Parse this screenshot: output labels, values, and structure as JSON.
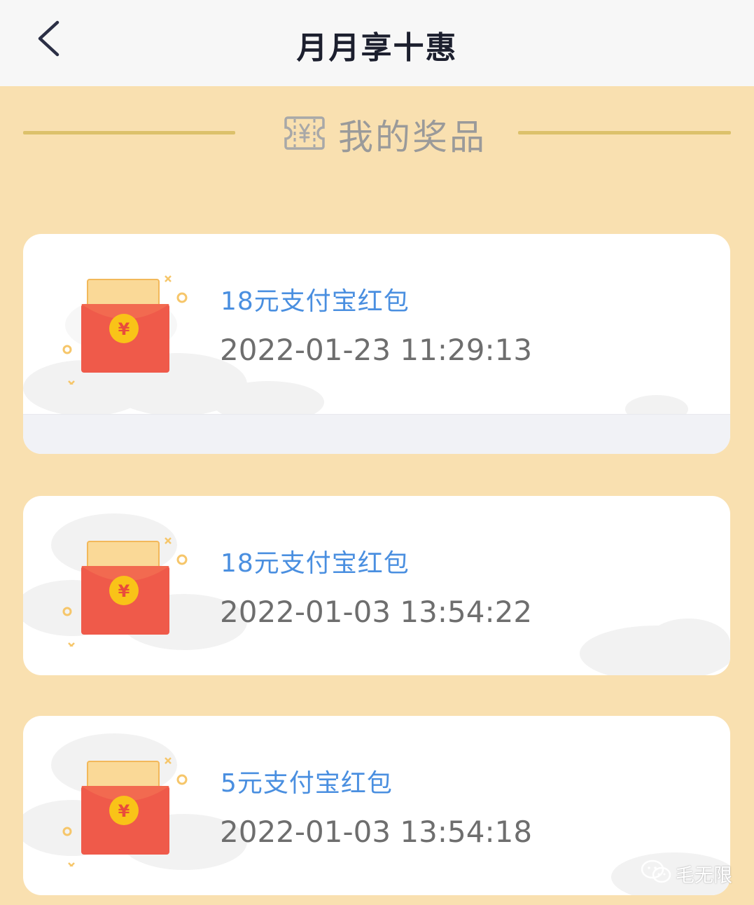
{
  "navbar": {
    "back_icon": "chevron-left-icon",
    "title": "月月享十惠"
  },
  "section": {
    "icon": "ticket-yen-icon",
    "title": "我的奖品"
  },
  "prizes": [
    {
      "name": "18元支付宝红包",
      "time": "2022-01-23 11:29:13",
      "icon": "red-envelope-icon"
    },
    {
      "name": "18元支付宝红包",
      "time": "2022-01-03 13:54:22",
      "icon": "red-envelope-icon"
    },
    {
      "name": "5元支付宝红包",
      "time": "2022-01-03 13:54:18",
      "icon": "red-envelope-icon"
    }
  ],
  "watermark": {
    "icon": "wechat-icon",
    "text": "毛无限"
  },
  "colors": {
    "page_background": "#f9e0b0",
    "navbar_background": "#f7f7f7",
    "divider": "#dcc16b",
    "prize_name": "#4a8fe0",
    "prize_time": "#6e6e6e",
    "envelope_red": "#ee5548",
    "coin_yellow": "#f8c21a"
  }
}
